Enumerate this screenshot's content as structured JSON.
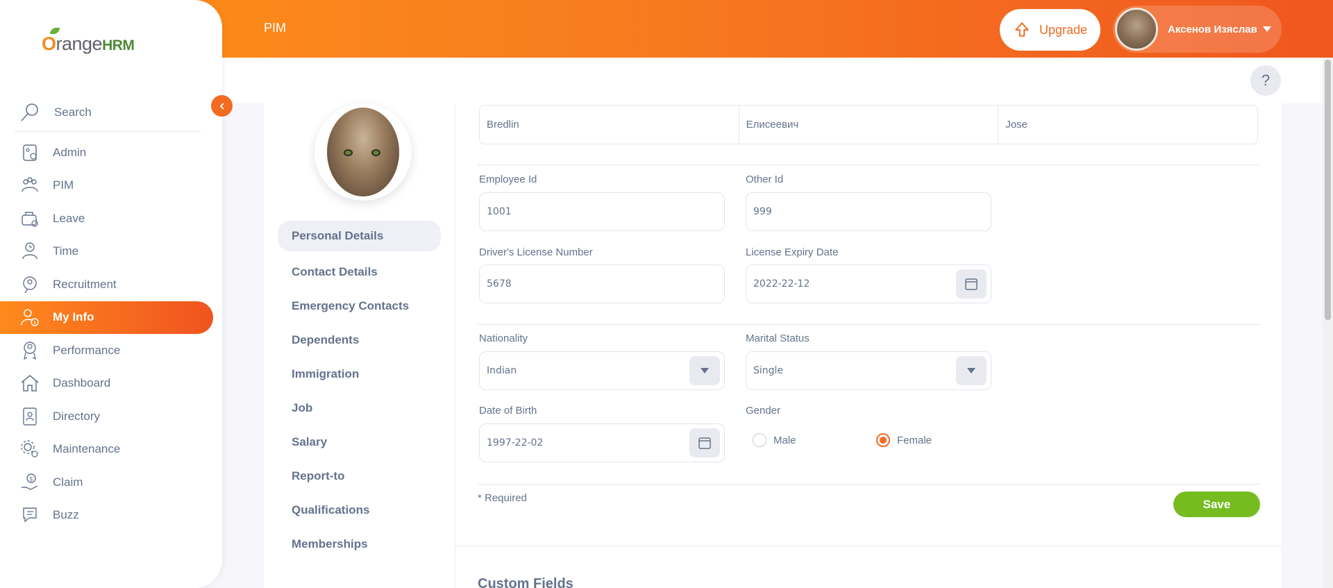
{
  "brand": {
    "name_part1": "range",
    "name_part2": "HRM",
    "o": "O"
  },
  "header": {
    "title": "PIM",
    "upgrade_label": "Upgrade",
    "user_name": "Аксенов Изяслав"
  },
  "sidebar": {
    "search_label": "Search",
    "items": [
      {
        "label": "Admin",
        "icon": "admin-icon"
      },
      {
        "label": "PIM",
        "icon": "pim-icon"
      },
      {
        "label": "Leave",
        "icon": "leave-icon"
      },
      {
        "label": "Time",
        "icon": "time-icon"
      },
      {
        "label": "Recruitment",
        "icon": "recruitment-icon"
      },
      {
        "label": "My Info",
        "icon": "my-info-icon",
        "active": true
      },
      {
        "label": "Performance",
        "icon": "performance-icon"
      },
      {
        "label": "Dashboard",
        "icon": "dashboard-icon"
      },
      {
        "label": "Directory",
        "icon": "directory-icon"
      },
      {
        "label": "Maintenance",
        "icon": "maintenance-icon"
      },
      {
        "label": "Claim",
        "icon": "claim-icon"
      },
      {
        "label": "Buzz",
        "icon": "buzz-icon"
      }
    ]
  },
  "help_label": "?",
  "tabs": [
    {
      "label": "Personal Details",
      "active": true
    },
    {
      "label": "Contact Details"
    },
    {
      "label": "Emergency Contacts"
    },
    {
      "label": "Dependents"
    },
    {
      "label": "Immigration"
    },
    {
      "label": "Job"
    },
    {
      "label": "Salary"
    },
    {
      "label": "Report-to"
    },
    {
      "label": "Qualifications"
    },
    {
      "label": "Memberships"
    }
  ],
  "form": {
    "first_name": "Bredlin",
    "middle_name": "Елисеевич",
    "last_name": "Jose",
    "employee_id_label": "Employee Id",
    "employee_id": "1001",
    "other_id_label": "Other Id",
    "other_id": "999",
    "license_label": "Driver's License Number",
    "license": "5678",
    "license_expiry_label": "License Expiry Date",
    "license_expiry": "2022-22-12",
    "nationality_label": "Nationality",
    "nationality": "Indian",
    "marital_label": "Marital Status",
    "marital": "Single",
    "dob_label": "Date of Birth",
    "dob": "1997-22-02",
    "gender_label": "Gender",
    "gender_male": "Male",
    "gender_female": "Female",
    "gender_selected": "Female",
    "required_note": "* Required",
    "save_label": "Save"
  },
  "custom_fields_title": "Custom Fields",
  "colors": {
    "accent": "#f26b21",
    "save": "#76bc21"
  }
}
